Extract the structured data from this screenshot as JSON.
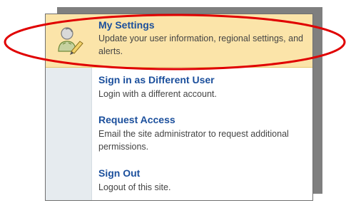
{
  "menu": {
    "items": [
      {
        "title": "My Settings",
        "description": "Update your user information, regional settings, and alerts."
      },
      {
        "title": "Sign in as Different User",
        "description": "Login with a different account."
      },
      {
        "title": "Request Access",
        "description": "Email the site administrator to request additional permissions."
      },
      {
        "title": "Sign Out",
        "description": "Logout of this site."
      }
    ]
  },
  "colors": {
    "highlight": "#fbe4a9",
    "link": "#1b4f9c",
    "annotation": "#e00000"
  }
}
